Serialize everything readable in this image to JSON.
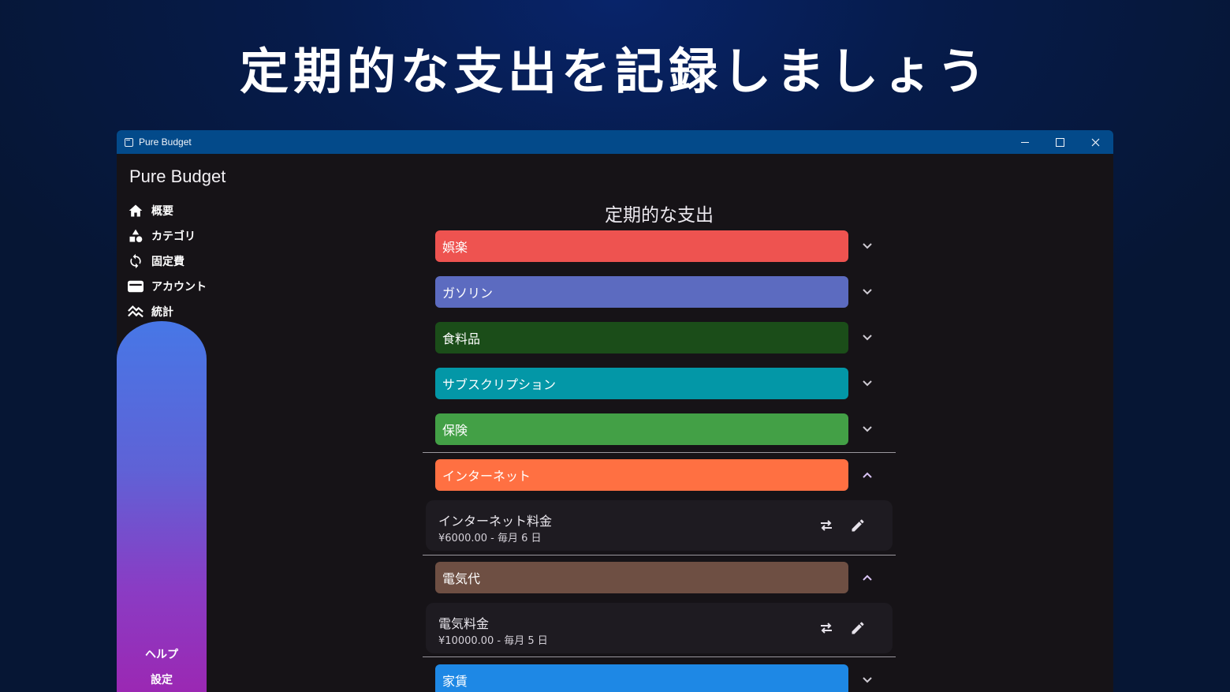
{
  "hero": {
    "title": "定期的な支出を記録しましょう"
  },
  "window": {
    "title": "Pure Budget",
    "controls": {
      "minimize_icon": "minimize-icon",
      "maximize_icon": "maximize-icon",
      "close_icon": "close-icon"
    },
    "titlebar_color": "#034a8a",
    "background": "#161317"
  },
  "sidebar": {
    "brand": "Pure Budget",
    "items": [
      {
        "label": "概要",
        "icon": "home-icon"
      },
      {
        "label": "カテゴリ",
        "icon": "shapes-icon"
      },
      {
        "label": "固定費",
        "icon": "sync-icon"
      },
      {
        "label": "アカウント",
        "icon": "wallet-icon"
      },
      {
        "label": "統計",
        "icon": "chart-icon"
      }
    ],
    "help": "ヘルプ",
    "settings": "設定",
    "accent_gradient": [
      "#4777e6",
      "#9b28b3"
    ]
  },
  "main": {
    "title": "定期的な支出",
    "categories": [
      {
        "label": "娯楽",
        "color": "#ee5350",
        "expanded": false
      },
      {
        "label": "ガソリン",
        "color": "#5c6bc0",
        "expanded": false
      },
      {
        "label": "食料品",
        "color": "#1b4d19",
        "expanded": false
      },
      {
        "label": "サブスクリプション",
        "color": "#0397a7",
        "expanded": false
      },
      {
        "label": "保険",
        "color": "#43a046",
        "expanded": false
      },
      {
        "label": "インターネット",
        "color": "#ff7042",
        "expanded": true,
        "items": [
          {
            "name": "インターネット料金",
            "detail": "¥6000.00 - 毎月 6 日"
          }
        ]
      },
      {
        "label": "電気代",
        "color": "#6e4f43",
        "expanded": true,
        "items": [
          {
            "name": "電気料金",
            "detail": "¥10000.00 - 毎月 5 日"
          }
        ]
      },
      {
        "label": "家賃",
        "color": "#1e88e5",
        "expanded": false
      }
    ],
    "item_actions": {
      "transfer_icon": "swap-icon",
      "edit_icon": "edit-icon"
    }
  }
}
